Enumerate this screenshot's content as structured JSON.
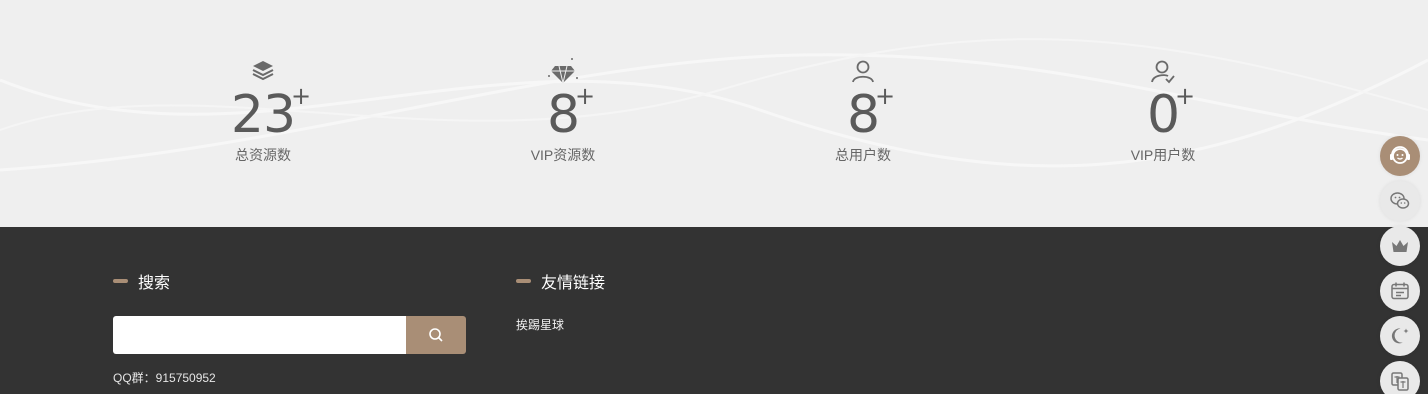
{
  "stats": [
    {
      "icon": "layers-icon",
      "value": "23",
      "suffix": "+",
      "label": "总资源数"
    },
    {
      "icon": "diamond-icon",
      "value": "8",
      "suffix": "+",
      "label": "VIP资源数"
    },
    {
      "icon": "user-icon",
      "value": "8",
      "suffix": "+",
      "label": "总用户数"
    },
    {
      "icon": "user-check-icon",
      "value": "0",
      "suffix": "+",
      "label": "VIP用户数"
    }
  ],
  "footer": {
    "search": {
      "title": "搜索",
      "value": "",
      "placeholder": ""
    },
    "qq": "QQ群：915750952",
    "links_title": "友情链接",
    "links": [
      "挨踢星球"
    ]
  },
  "sidebar_tools": [
    "customer-service-icon",
    "wechat-icon",
    "crown-icon",
    "calendar-icon",
    "moon-icon",
    "translate-icon"
  ],
  "colors": {
    "accent": "#a98e76",
    "footer_bg": "#333333",
    "stats_bg": "#efefef",
    "text": "#5a5a5a"
  }
}
